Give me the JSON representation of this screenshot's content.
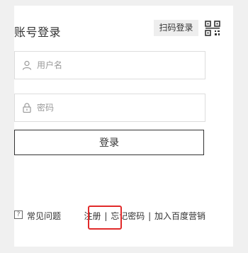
{
  "header": {
    "title": "账号登录",
    "qr_login_label": "扫码登录",
    "qr_icon": "qr-code-icon"
  },
  "form": {
    "username": {
      "placeholder": "用户名",
      "icon": "user-icon",
      "value": ""
    },
    "password": {
      "placeholder": "密码",
      "icon": "lock-icon",
      "value": ""
    },
    "login_label": "登录"
  },
  "footer": {
    "faq_icon_glyph": "?",
    "faq_label": "常见问题",
    "register_label": "注册",
    "separator": "|",
    "forgot_label": "忘记密码",
    "join_label": "加入百度营销"
  },
  "colors": {
    "highlight": "#e12a2a",
    "text": "#333333",
    "border": "#dddddd"
  }
}
